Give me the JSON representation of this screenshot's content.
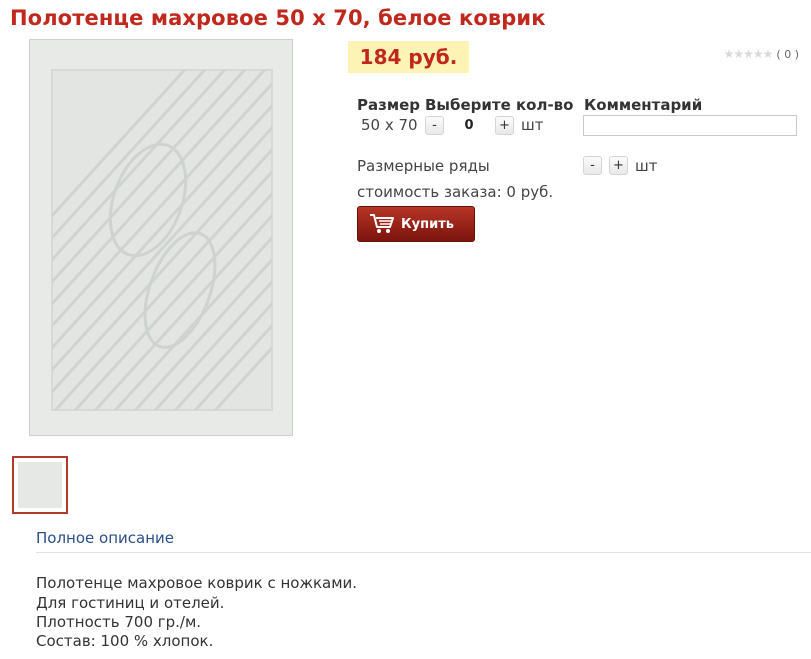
{
  "product": {
    "title": "Полотенце махровое 50 х 70, белое коврик",
    "price": "184 руб.",
    "rating_stars": "★★★★★",
    "review_count": "( 0 )"
  },
  "table": {
    "header_size": "Размер",
    "header_qty": "Выберите кол-во",
    "header_comment": "Комментарий",
    "row_size": "50 х 70",
    "row_qty": "0",
    "unit": "шт",
    "minus": "-",
    "plus": "+"
  },
  "size_series": {
    "label": "Размерные ряды",
    "minus": "-",
    "plus": "+",
    "unit": "шт"
  },
  "order": {
    "total": "стоимость заказа: 0 руб.",
    "buy_label": "Купить"
  },
  "description": {
    "link": "Полное описание",
    "lines": [
      "Полотенце махровое коврик с ножками.",
      "Для гостиниц и отелей.",
      "Плотность 700 гр./м.",
      "Состав: 100 %  хлопок."
    ]
  },
  "colors": {
    "title": "#c0281d",
    "price_bg": "#fdf3b5",
    "button": "#9a2418",
    "link": "#2a4e8a"
  }
}
